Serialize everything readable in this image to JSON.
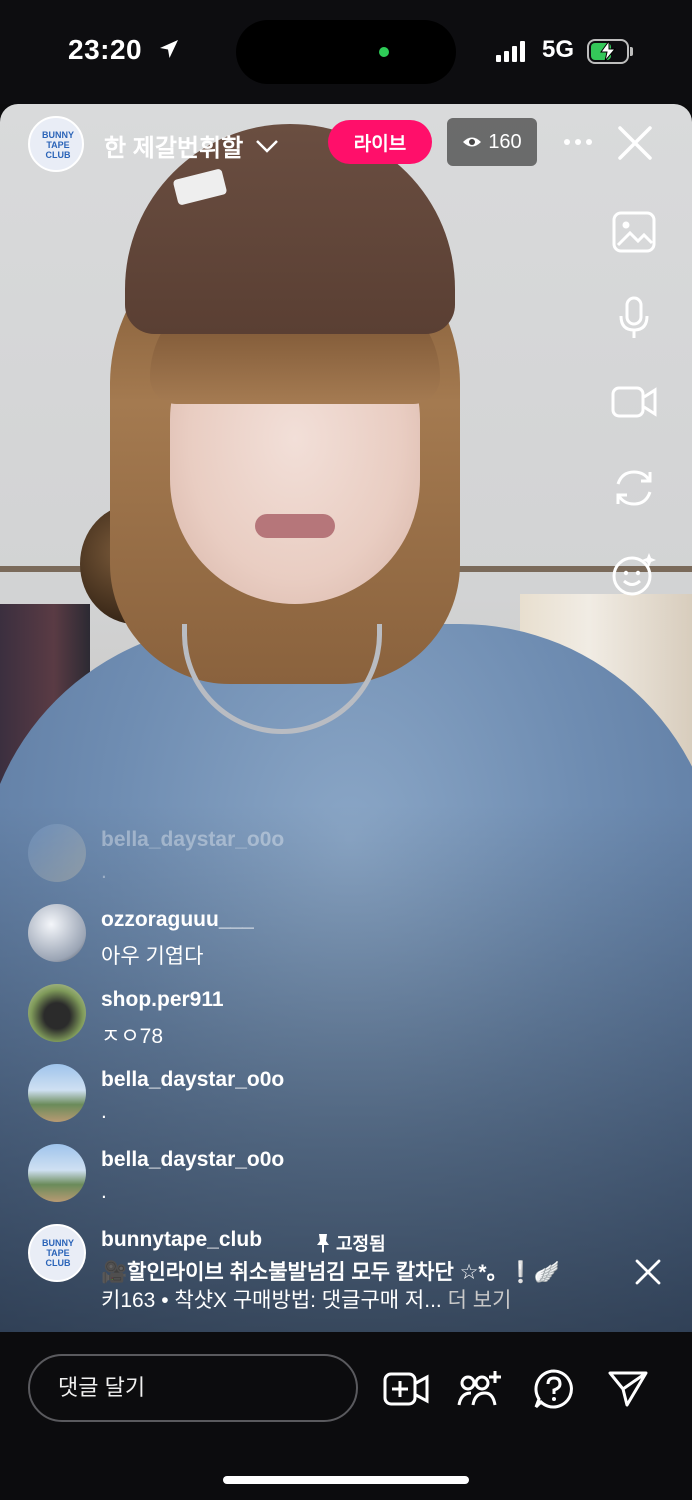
{
  "status_bar": {
    "time": "23:20",
    "network": "5G"
  },
  "header": {
    "avatar_logo_text": "BUNNY TAPE CLUB",
    "channel_name": "한 제갈번휘할",
    "live_label": "라이브",
    "viewer_count": "160"
  },
  "comments": [
    {
      "user": "bella_daystar_o0o",
      "message": "."
    },
    {
      "user": "ozzoraguuu___",
      "message": "아우 기엽다"
    },
    {
      "user": "shop.per911",
      "message": "ㅈㅇ78"
    },
    {
      "user": "bella_daystar_o0o",
      "message": "."
    },
    {
      "user": "bella_daystar_o0o",
      "message": "."
    }
  ],
  "pinned": {
    "user": "bunnytape_club",
    "pin_label": "고정됨",
    "line1": "🎥할인라이브 취소불발넘김 모두 칼차단 ☆*。❕🪽",
    "line2": "키163 • 착샷X 구매방법: 댓글구매 저...",
    "more": "더 보기"
  },
  "bottom_bar": {
    "comment_placeholder": "댓글 달기"
  },
  "icons": {
    "top": [
      "chevron-down-icon",
      "eye-icon",
      "more-icon",
      "close-icon"
    ],
    "side": [
      "gallery-icon",
      "microphone-icon",
      "video-camera-icon",
      "flip-camera-icon",
      "face-effects-icon"
    ],
    "bottom": [
      "add-video-icon",
      "invite-guest-icon",
      "question-icon",
      "send-icon"
    ]
  },
  "colors": {
    "live_pill": "#ff0f6a",
    "battery": "#34c759",
    "island_dot": "#2ecc57"
  }
}
